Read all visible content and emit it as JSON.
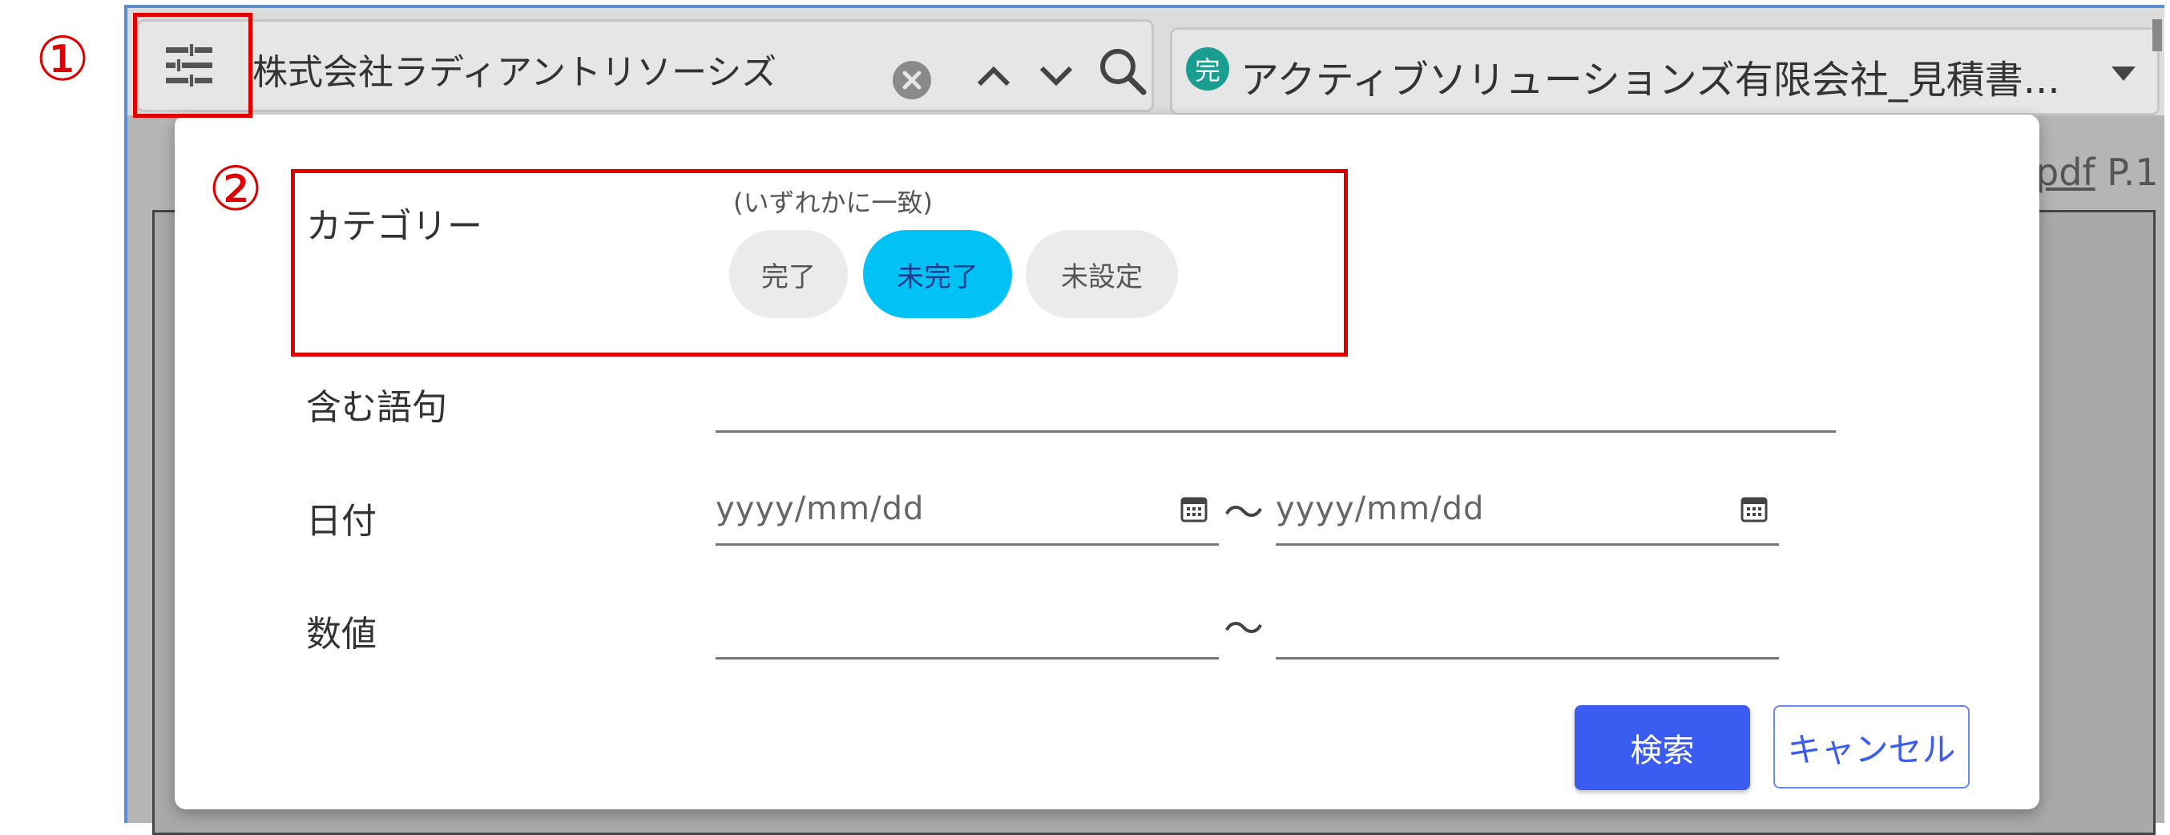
{
  "annotations": {
    "marker1": "①",
    "marker2": "②"
  },
  "toolbar": {
    "search_value": "株式会社ラディアントリソーシズ",
    "icons": [
      "filter-icon",
      "clear-icon",
      "chevron-up-icon",
      "chevron-down-icon",
      "search-icon"
    ]
  },
  "document": {
    "badge": "完",
    "title": "アクティブソリューションズ有限会社_見積書...",
    "page_label_pdf": "pdf",
    "page_label_page": "P.1"
  },
  "dialog": {
    "category": {
      "label": "カテゴリー",
      "hint": "(いずれかに一致)",
      "chips": [
        {
          "label": "完了",
          "selected": false
        },
        {
          "label": "未完了",
          "selected": true
        },
        {
          "label": "未設定",
          "selected": false
        }
      ]
    },
    "keywords": {
      "label": "含む語句",
      "value": ""
    },
    "date": {
      "label": "日付",
      "from_placeholder": "yyyy/mm/dd",
      "to_placeholder": "yyyy/mm/dd",
      "separator": "〜"
    },
    "number": {
      "label": "数値",
      "separator": "〜"
    },
    "buttons": {
      "search": "検索",
      "cancel": "キャンセル"
    }
  },
  "colors": {
    "accent": "#3b5cf0",
    "chip_active": "#00c2f5",
    "annotation": "#e00000"
  }
}
